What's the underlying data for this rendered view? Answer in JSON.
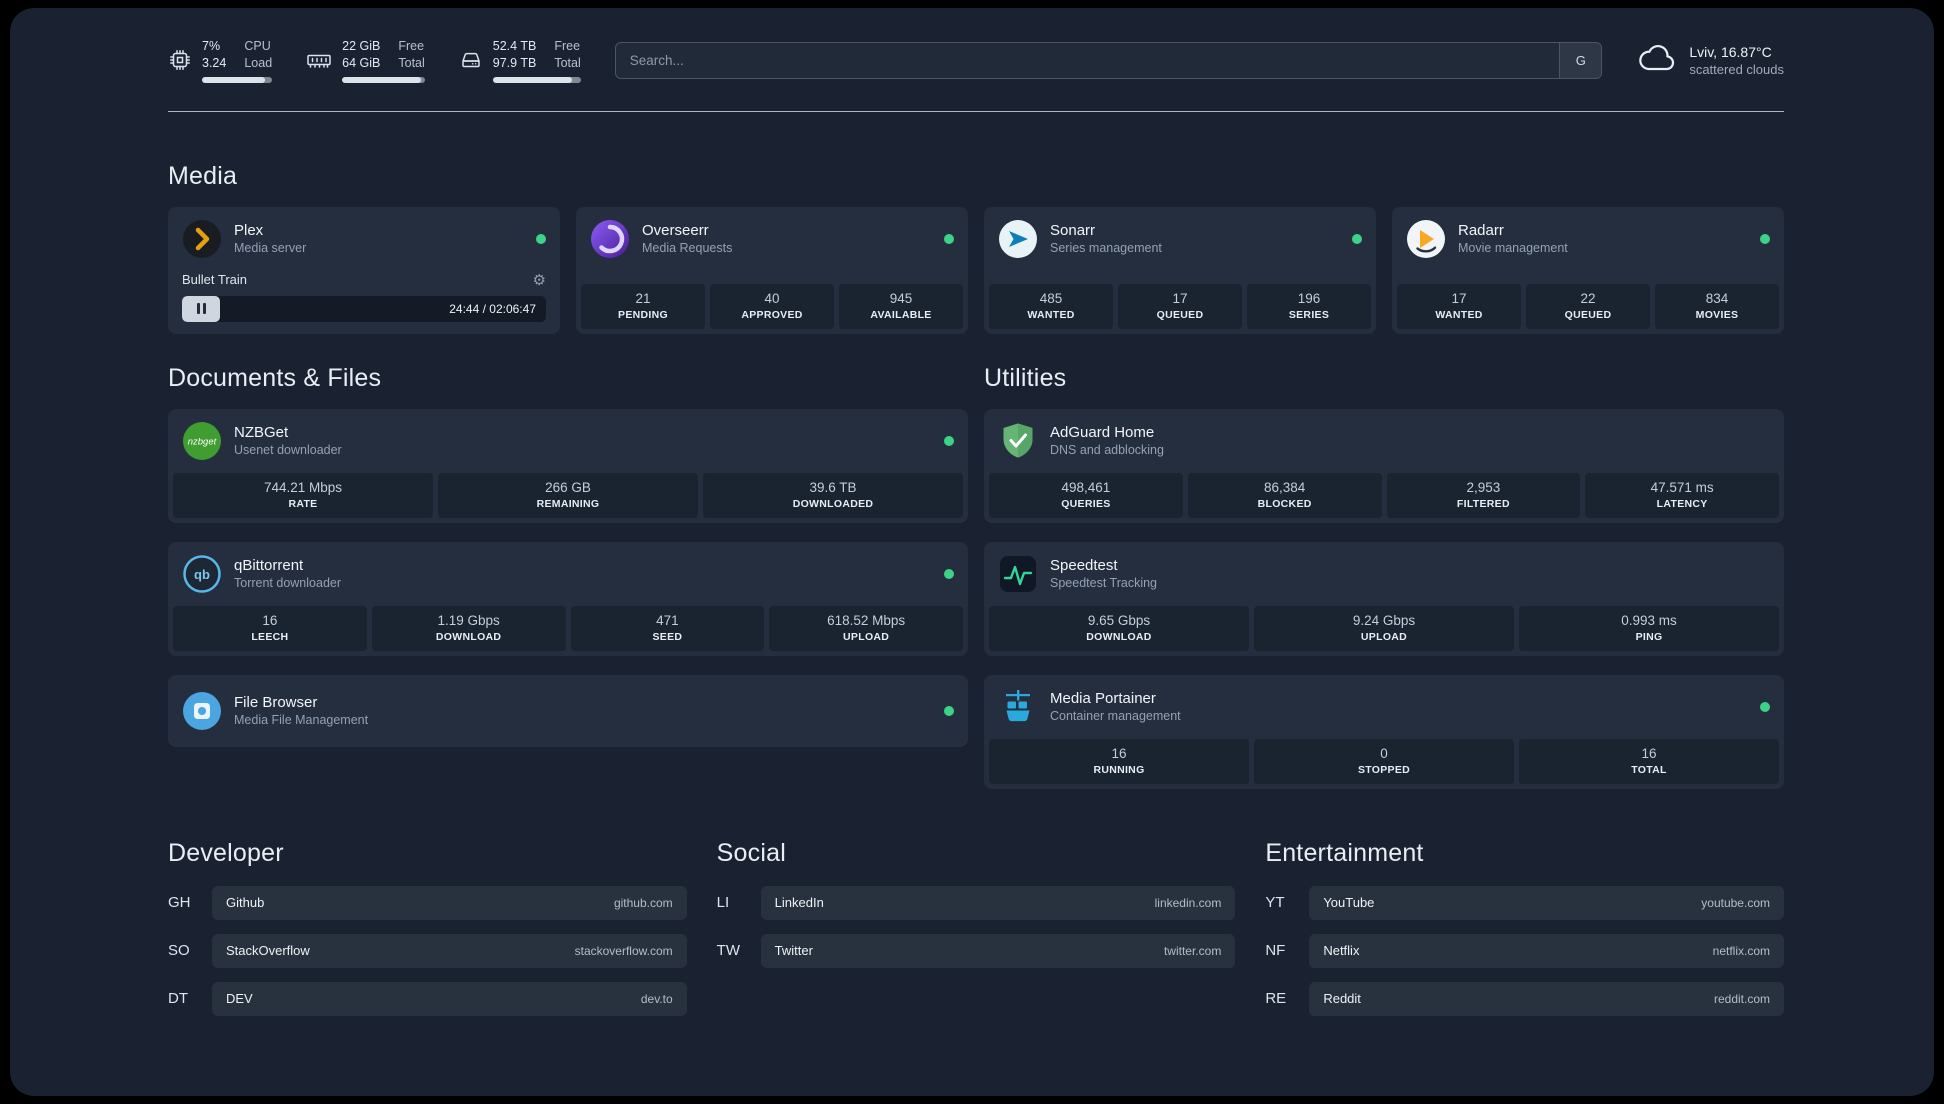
{
  "colors": {
    "background": "#1a2232",
    "card": "#242e3f",
    "stat_tile": "#1a2330",
    "status_online": "#3dd387",
    "plex_gold": "#e5a00d",
    "speedtest_green": "#34d399",
    "portainer_blue": "#2aa9de"
  },
  "topbar": {
    "resources": [
      {
        "icon": "cpu-icon",
        "values": [
          "7%",
          "3.24"
        ],
        "labels": [
          "CPU",
          "Load"
        ],
        "bar_pct": 90
      },
      {
        "icon": "memory-icon",
        "values": [
          "22 GiB",
          "64 GiB"
        ],
        "labels": [
          "Free",
          "Total"
        ],
        "bar_pct": 95
      },
      {
        "icon": "disk-icon",
        "values": [
          "52.4 TB",
          "97.9 TB"
        ],
        "labels": [
          "Free",
          "Total"
        ],
        "bar_pct": 90
      }
    ],
    "search": {
      "placeholder": "Search...",
      "provider_button": "G"
    },
    "weather": {
      "icon": "cloud-icon",
      "location": "Lviv, 16.87°C",
      "condition": "scattered clouds"
    }
  },
  "sections": {
    "media": {
      "title": "Media",
      "cards": [
        {
          "icon": "plex-icon",
          "name": "Plex",
          "subtitle": "Media server",
          "status": "online",
          "player": {
            "track": "Bullet Train",
            "time": "24:44 / 02:06:47"
          }
        },
        {
          "icon": "overseerr-icon",
          "name": "Overseerr",
          "subtitle": "Media Requests",
          "status": "online",
          "stats": [
            {
              "value": "21",
              "label": "PENDING"
            },
            {
              "value": "40",
              "label": "APPROVED"
            },
            {
              "value": "945",
              "label": "AVAILABLE"
            }
          ]
        },
        {
          "icon": "sonarr-icon",
          "name": "Sonarr",
          "subtitle": "Series management",
          "status": "online",
          "stats": [
            {
              "value": "485",
              "label": "WANTED"
            },
            {
              "value": "17",
              "label": "QUEUED"
            },
            {
              "value": "196",
              "label": "SERIES"
            }
          ]
        },
        {
          "icon": "radarr-icon",
          "name": "Radarr",
          "subtitle": "Movie management",
          "status": "online",
          "stats": [
            {
              "value": "17",
              "label": "WANTED"
            },
            {
              "value": "22",
              "label": "QUEUED"
            },
            {
              "value": "834",
              "label": "MOVIES"
            }
          ]
        }
      ]
    },
    "documents": {
      "title": "Documents & Files",
      "cards": [
        {
          "icon": "nzbget-icon",
          "name": "NZBGet",
          "subtitle": "Usenet downloader",
          "status": "online",
          "stats": [
            {
              "value": "744.21 Mbps",
              "label": "RATE"
            },
            {
              "value": "266 GB",
              "label": "REMAINING"
            },
            {
              "value": "39.6 TB",
              "label": "DOWNLOADED"
            }
          ]
        },
        {
          "icon": "qbittorrent-icon",
          "name": "qBittorrent",
          "subtitle": "Torrent downloader",
          "status": "online",
          "stats": [
            {
              "value": "16",
              "label": "LEECH"
            },
            {
              "value": "1.19 Gbps",
              "label": "DOWNLOAD"
            },
            {
              "value": "471",
              "label": "SEED"
            },
            {
              "value": "618.52 Mbps",
              "label": "UPLOAD"
            }
          ]
        },
        {
          "icon": "filebrowser-icon",
          "name": "File Browser",
          "subtitle": "Media File Management",
          "status": "online"
        }
      ]
    },
    "utilities": {
      "title": "Utilities",
      "cards": [
        {
          "icon": "adguard-icon",
          "name": "AdGuard Home",
          "subtitle": "DNS and adblocking",
          "stats": [
            {
              "value": "498,461",
              "label": "QUERIES"
            },
            {
              "value": "86,384",
              "label": "BLOCKED"
            },
            {
              "value": "2,953",
              "label": "FILTERED"
            },
            {
              "value": "47.571 ms",
              "label": "LATENCY"
            }
          ]
        },
        {
          "icon": "speedtest-icon",
          "name": "Speedtest",
          "subtitle": "Speedtest Tracking",
          "stats": [
            {
              "value": "9.65 Gbps",
              "label": "DOWNLOAD"
            },
            {
              "value": "9.24 Gbps",
              "label": "UPLOAD"
            },
            {
              "value": "0.993 ms",
              "label": "PING"
            }
          ]
        },
        {
          "icon": "portainer-icon",
          "name": "Media Portainer",
          "subtitle": "Container management",
          "status": "online",
          "stats": [
            {
              "value": "16",
              "label": "RUNNING"
            },
            {
              "value": "0",
              "label": "STOPPED"
            },
            {
              "value": "16",
              "label": "TOTAL"
            }
          ]
        }
      ]
    }
  },
  "bookmarks": [
    {
      "title": "Developer",
      "items": [
        {
          "abbr": "GH",
          "name": "Github",
          "url": "github.com"
        },
        {
          "abbr": "SO",
          "name": "StackOverflow",
          "url": "stackoverflow.com"
        },
        {
          "abbr": "DT",
          "name": "DEV",
          "url": "dev.to"
        }
      ]
    },
    {
      "title": "Social",
      "items": [
        {
          "abbr": "LI",
          "name": "LinkedIn",
          "url": "linkedin.com"
        },
        {
          "abbr": "TW",
          "name": "Twitter",
          "url": "twitter.com"
        }
      ]
    },
    {
      "title": "Entertainment",
      "items": [
        {
          "abbr": "YT",
          "name": "YouTube",
          "url": "youtube.com"
        },
        {
          "abbr": "NF",
          "name": "Netflix",
          "url": "netflix.com"
        },
        {
          "abbr": "RE",
          "name": "Reddit",
          "url": "reddit.com"
        }
      ]
    }
  ]
}
